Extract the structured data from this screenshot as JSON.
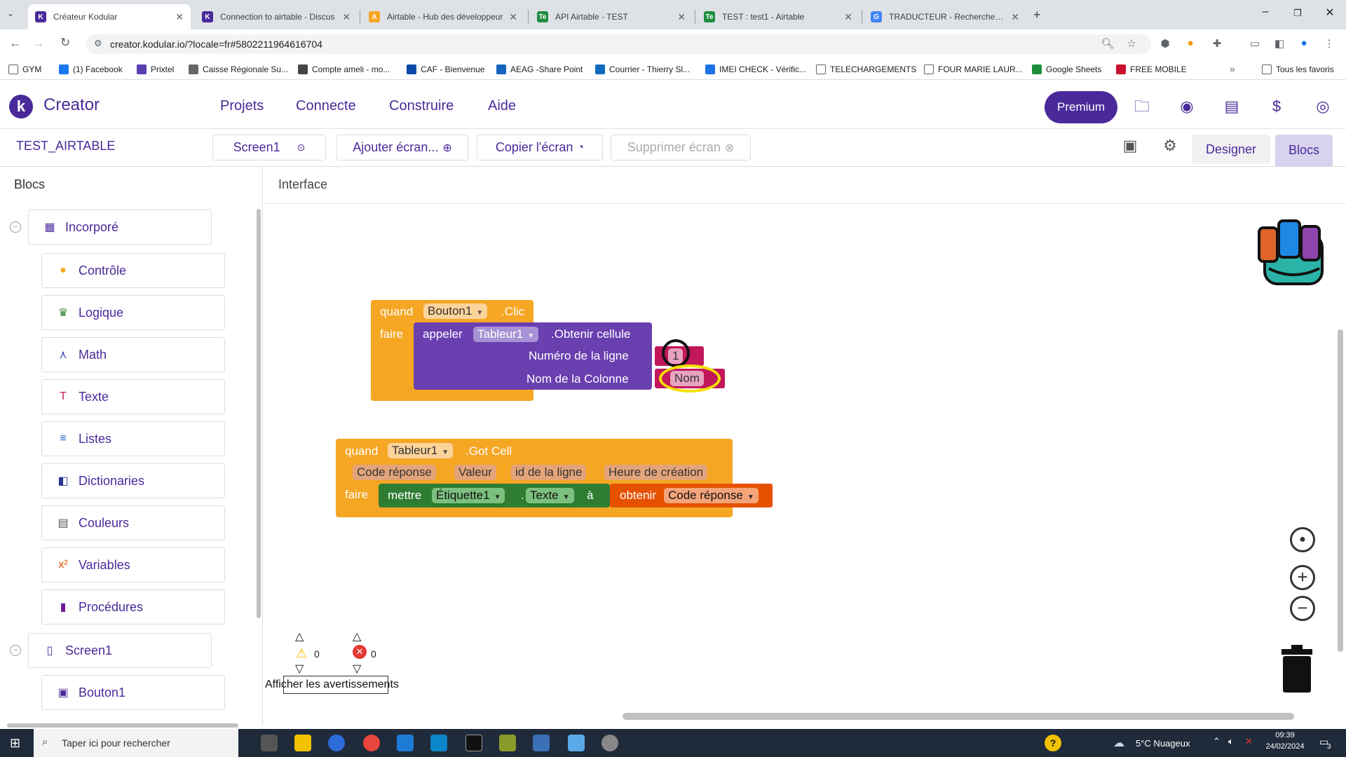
{
  "browser": {
    "tabs": [
      {
        "title": "Créateur Kodular",
        "active": true,
        "favicon": "K",
        "color": "#4a2a9a"
      },
      {
        "title": "Connection to airtable - Discus",
        "active": false,
        "favicon": "K",
        "color": "#4a2a9a"
      },
      {
        "title": "Airtable - Hub des développeur",
        "active": false,
        "favicon": "A",
        "color": "#f5a623"
      },
      {
        "title": "API Airtable - TEST",
        "active": false,
        "favicon": "Te",
        "color": "#1e8e3e"
      },
      {
        "title": "TEST : test1 - Airtable",
        "active": false,
        "favicon": "Te",
        "color": "#1e8e3e"
      },
      {
        "title": "TRADUCTEUR - Recherche Goo",
        "active": false,
        "favicon": "G",
        "color": "#4285f4"
      }
    ],
    "url": "creator.kodular.io/?locale=fr#5802211964616704",
    "bookmarks": [
      {
        "label": "GYM",
        "icon": "folder-icon"
      },
      {
        "label": "(1) Facebook",
        "icon": "facebook-icon"
      },
      {
        "label": "Prixtel",
        "icon": "prixtel-icon"
      },
      {
        "label": "Caisse Régionale Su...",
        "icon": "globe-icon"
      },
      {
        "label": "Compte ameli - mo...",
        "icon": "ameli-icon"
      },
      {
        "label": "CAF - Bienvenue",
        "icon": "caf-icon"
      },
      {
        "label": "AEAG -Share Point",
        "icon": "sharepoint-icon"
      },
      {
        "label": "Courrier - Thierry Sl...",
        "icon": "outlook-icon"
      },
      {
        "label": "IMEI CHECK - Vérific...",
        "icon": "imei-icon"
      },
      {
        "label": "TELECHARGEMENTS",
        "icon": "folder-icon"
      },
      {
        "label": "FOUR MARIE LAUR...",
        "icon": "folder-icon"
      },
      {
        "label": "Google Sheets",
        "icon": "sheets-icon"
      },
      {
        "label": "FREE MOBILE",
        "icon": "free-icon"
      }
    ],
    "bookmarks_more": "»",
    "all_favorites": "Tous les favoris"
  },
  "app": {
    "brand": "Creator",
    "menu": [
      "Projets",
      "Connecte",
      "Construire",
      "Aide"
    ],
    "premium_label": "Premium",
    "project_name": "TEST_AIRTABLE",
    "screen_select": "Screen1",
    "add_screen": "Ajouter écran...",
    "copy_screen": "Copier l'écran",
    "delete_screen": "Supprimer écran",
    "designer_label": "Designer",
    "blocks_label": "Blocs"
  },
  "left_panel": {
    "title": "Blocs",
    "builtin": "Incorporé",
    "categories": [
      {
        "label": "Contrôle",
        "icon": "control-icon",
        "color": "#f5a623"
      },
      {
        "label": "Logique",
        "icon": "logic-icon",
        "color": "#2e7d32"
      },
      {
        "label": "Math",
        "icon": "math-icon",
        "color": "#3949ab"
      },
      {
        "label": "Texte",
        "icon": "text-icon",
        "color": "#c2185b"
      },
      {
        "label": "Listes",
        "icon": "lists-icon",
        "color": "#1565c0"
      },
      {
        "label": "Dictionaries",
        "icon": "dictionaries-icon",
        "color": "#283593"
      },
      {
        "label": "Couleurs",
        "icon": "colors-icon",
        "color": "#555555"
      },
      {
        "label": "Variables",
        "icon": "variables-icon",
        "color": "#e65100"
      },
      {
        "label": "Procédures",
        "icon": "procedures-icon",
        "color": "#6a1b9a"
      }
    ],
    "screen": "Screen1",
    "component": "Bouton1"
  },
  "workspace": {
    "title": "Interface",
    "block1": {
      "when": "quand",
      "component": "Bouton1",
      "event": ".Clic",
      "do": "faire",
      "call": "appeler",
      "target": "Tableur1",
      "method": ".Obtenir cellule",
      "arg1_label": "Numéro de la ligne",
      "arg1_value": "1",
      "arg2_label": "Nom de la Colonne",
      "arg2_value": "Nom"
    },
    "block2": {
      "when": "quand",
      "component": "Tableur1",
      "event": ".Got Cell",
      "params": [
        "Code réponse",
        "Valeur",
        "id de la ligne",
        "Heure de création"
      ],
      "do": "faire",
      "set": "mettre",
      "set_component": "Étiquette1",
      "dot": ".",
      "property": "Texte",
      "to": "à",
      "get": "obtenir",
      "get_var": "Code réponse"
    },
    "warnings_count": "0",
    "errors_count": "0",
    "show_warnings": "Afficher les avertissements"
  },
  "taskbar": {
    "search_placeholder": "Taper ici pour rechercher",
    "weather": "5°C  Nuageux",
    "time": "09:39",
    "date": "24/02/2024",
    "notifications": "3"
  }
}
